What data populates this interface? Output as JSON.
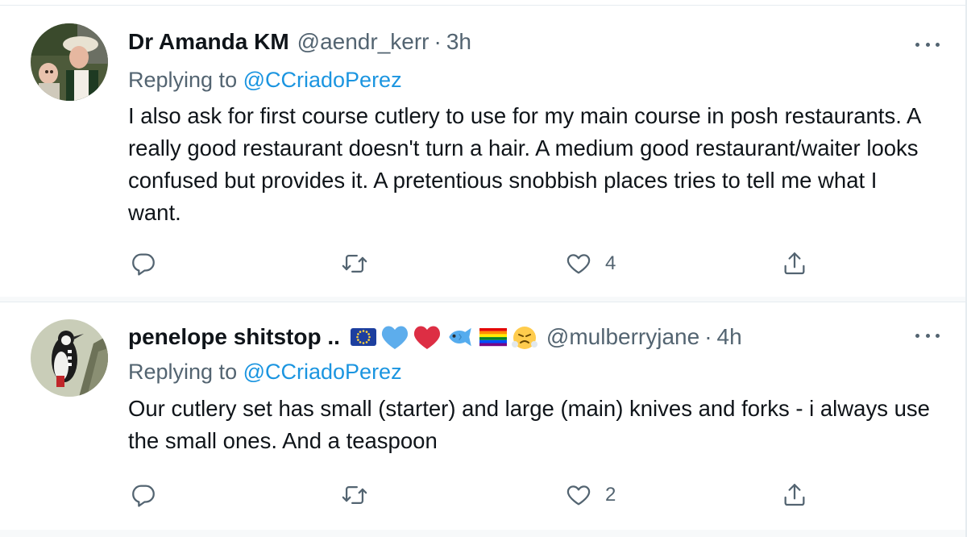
{
  "tweets": [
    {
      "display_name": "Dr Amanda KM",
      "handle": "@aendr_kerr",
      "time": "3h",
      "replying_prefix": "Replying to ",
      "replying_to": "@CCriadoPerez",
      "text": "I also ask for first course cutlery to use for my main course in posh restaurants. A really good restaurant doesn't turn a hair. A medium good restaurant/waiter looks confused but provides it. A pretentious snobbish places tries to tell me what I want.",
      "like_count": "4",
      "avatar_icon": "avatar-photo-woman-child"
    },
    {
      "display_name": "penelope shitstop ..",
      "emojis": [
        "eu-flag-emoji",
        "blue-heart-emoji",
        "red-heart-emoji",
        "fish-emoji",
        "rainbow-flag-emoji",
        "steam-face-emoji"
      ],
      "handle": "@mulberryjane",
      "time": "4h",
      "replying_prefix": "Replying to ",
      "replying_to": "@CCriadoPerez",
      "text": "Our cutlery set has small (starter) and large (main) knives and forks - i always use the small ones. And a teaspoon",
      "like_count": "2",
      "avatar_icon": "avatar-woodpecker"
    }
  ],
  "separator_dot": "·",
  "colors": {
    "link": "#1b95e0",
    "secondary_text": "#536471",
    "primary_text": "#0f1419",
    "border": "#e6ecf0"
  }
}
